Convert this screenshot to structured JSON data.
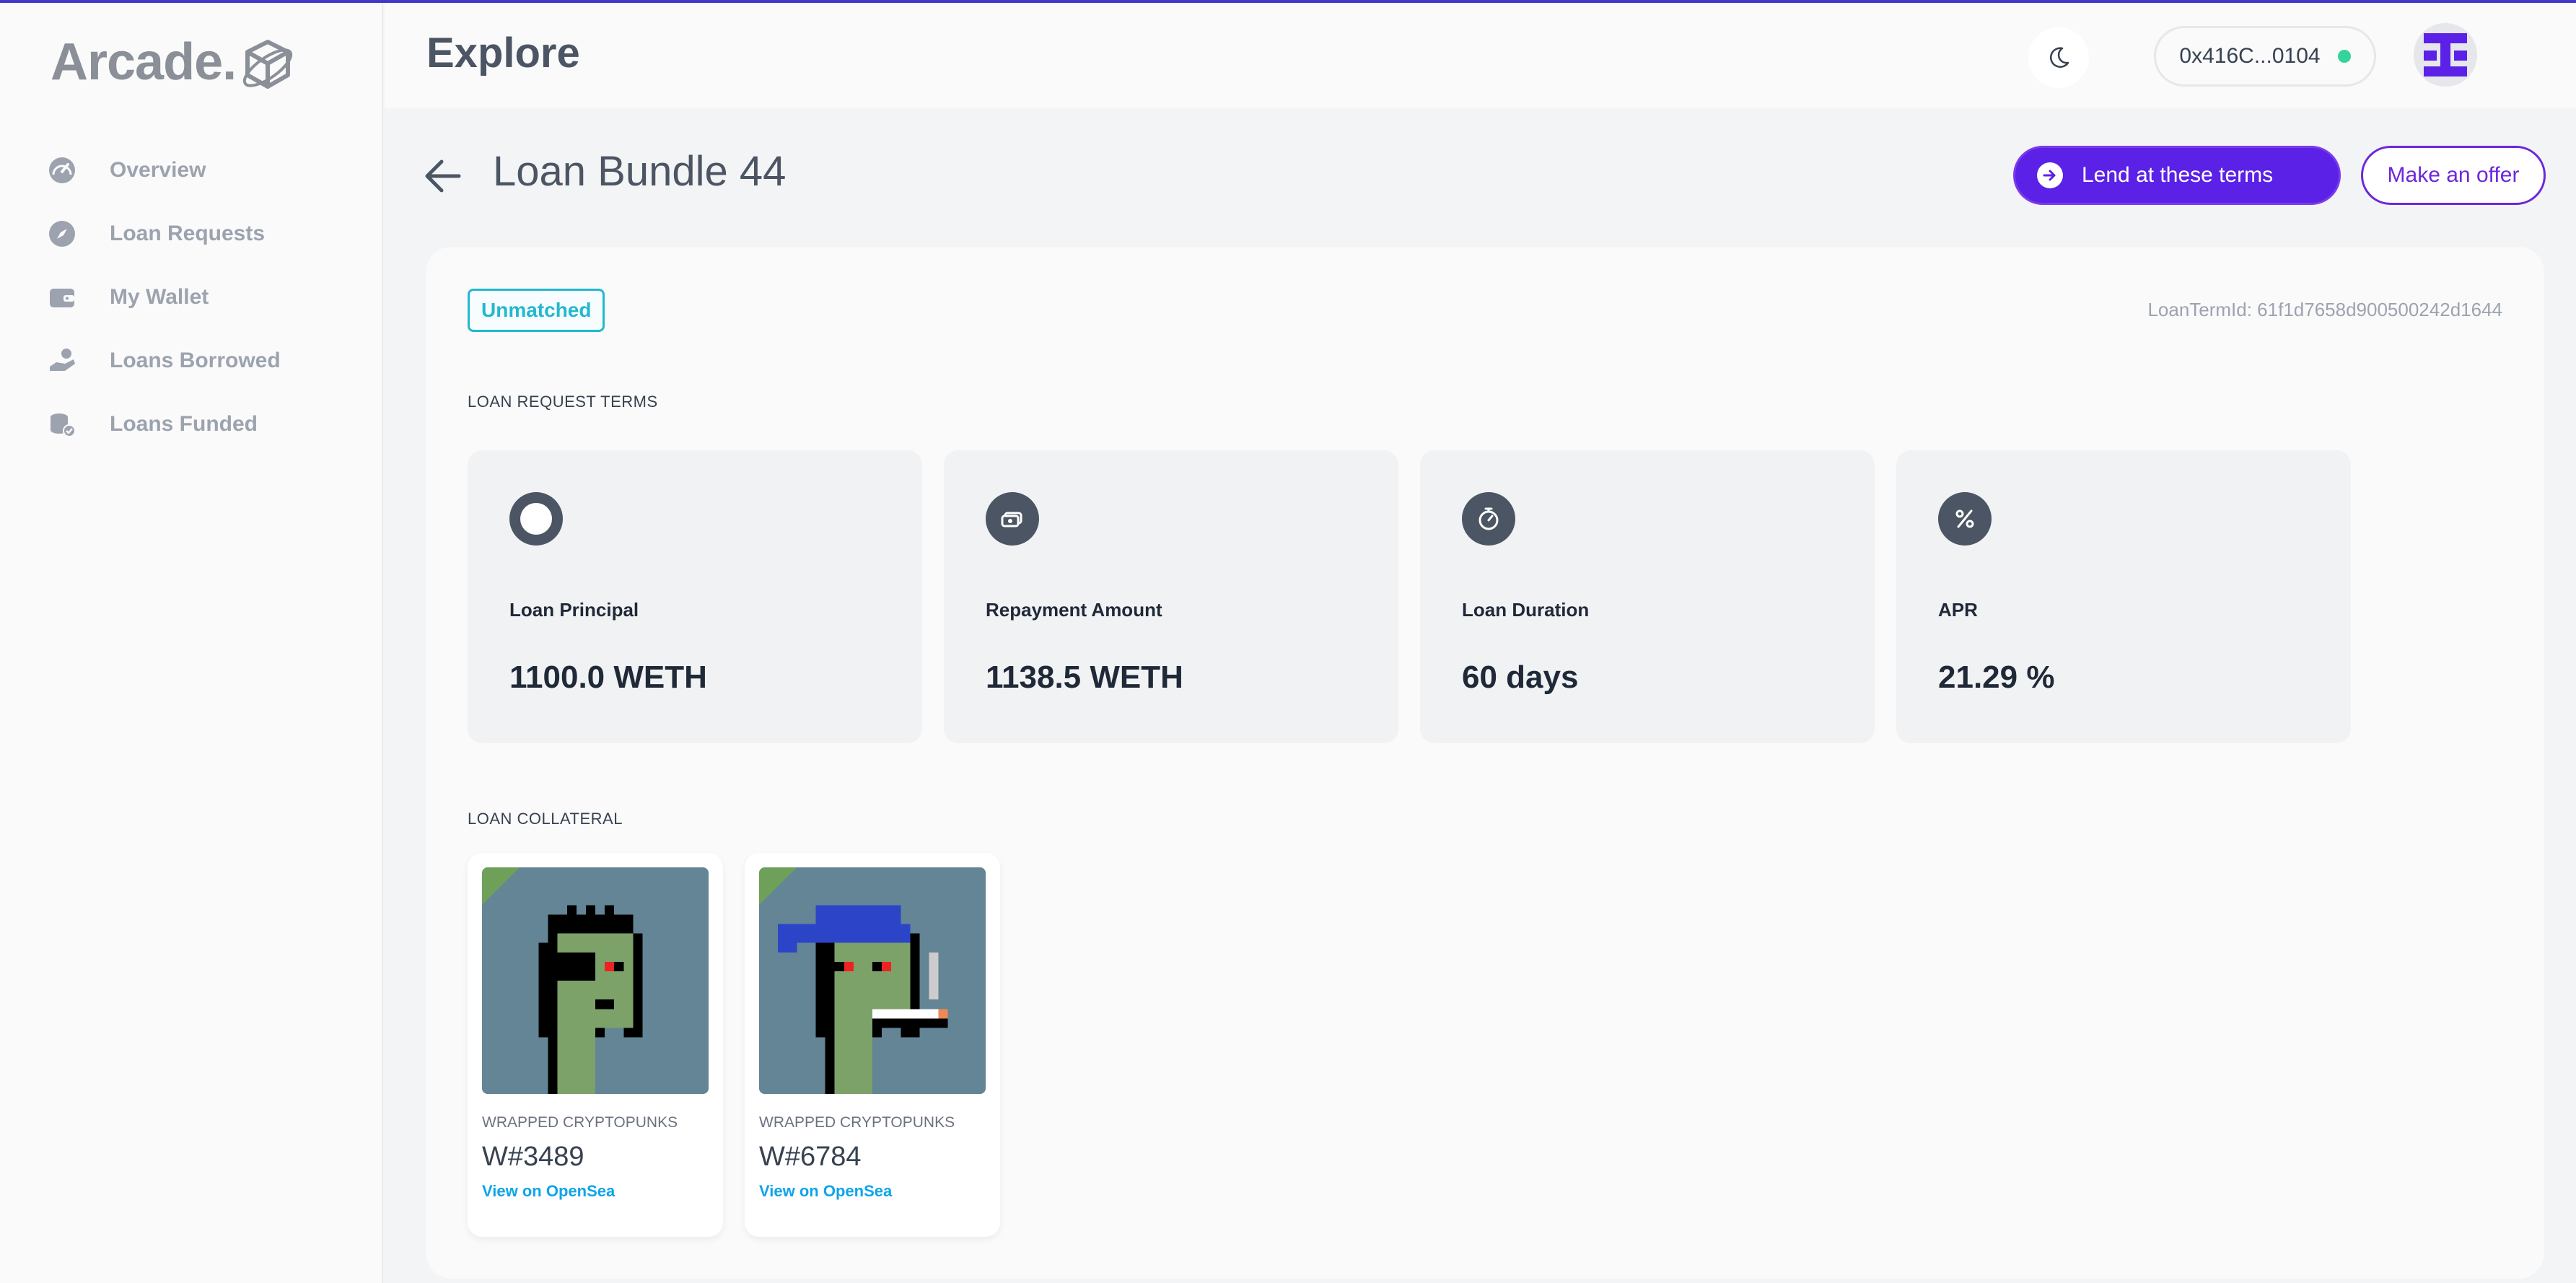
{
  "app": {
    "logo_text": "Arcade."
  },
  "sidebar": {
    "items": [
      {
        "label": "Overview",
        "icon": "speedometer-icon"
      },
      {
        "label": "Loan Requests",
        "icon": "compass-icon"
      },
      {
        "label": "My Wallet",
        "icon": "wallet-icon"
      },
      {
        "label": "Loans Borrowed",
        "icon": "hand-coin-icon"
      },
      {
        "label": "Loans Funded",
        "icon": "coins-check-icon"
      }
    ]
  },
  "header": {
    "title": "Explore",
    "wallet_address": "0x416C...0104",
    "wallet_status_color": "#34d399"
  },
  "page": {
    "title": "Loan Bundle 44",
    "lend_button": "Lend at these terms",
    "offer_button": "Make an offer",
    "status_badge": "Unmatched",
    "loan_term_id": "LoanTermId: 61f1d7658d900500242d1644",
    "terms_section_label": "LOAN REQUEST TERMS",
    "collateral_section_label": "LOAN COLLATERAL"
  },
  "terms": [
    {
      "label": "Loan Principal",
      "value": "1100.0 WETH",
      "icon": "circle-icon"
    },
    {
      "label": "Repayment Amount",
      "value": "1138.5 WETH",
      "icon": "cash-icon"
    },
    {
      "label": "Loan Duration",
      "value": "60 days",
      "icon": "stopwatch-icon"
    },
    {
      "label": "APR",
      "value": "21.29 %",
      "icon": "percent-icon"
    }
  ],
  "collateral": [
    {
      "collection": "WRAPPED CRYPTOPUNKS",
      "name": "W#3489",
      "link": "View on OpenSea"
    },
    {
      "collection": "WRAPPED CRYPTOPUNKS",
      "name": "W#6784",
      "link": "View on OpenSea"
    }
  ],
  "colors": {
    "accent": "#5b21e6",
    "badge": "#22b8cf",
    "link": "#0ea5e9"
  }
}
